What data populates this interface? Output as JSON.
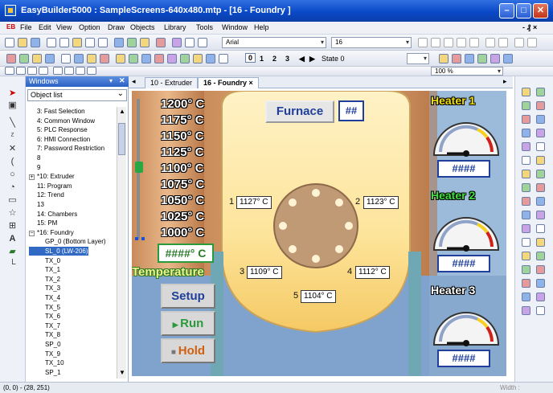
{
  "window": {
    "title": "EasyBuilder5000 : SampleScreens-640x480.mtp - [16 - Foundry ]"
  },
  "menubar": {
    "badge": "EB",
    "items": [
      "File",
      "Edit",
      "View",
      "Option",
      "Draw",
      "Objects",
      "Library",
      "Tools",
      "Window",
      "Help"
    ]
  },
  "toolbar": {
    "font_combo": "Arial",
    "size_combo": "16",
    "layers": [
      "0",
      "1",
      "2",
      "3"
    ],
    "state_label": "State 0",
    "zoom_combo": "100 %"
  },
  "panel": {
    "title": "Windows",
    "select_value": "Object list",
    "tree": [
      {
        "label": "3: Fast Selection",
        "indent": 1,
        "pm": ""
      },
      {
        "label": "4: Common Window",
        "indent": 1,
        "pm": ""
      },
      {
        "label": "5: PLC Response",
        "indent": 1,
        "pm": ""
      },
      {
        "label": "6: HMI Connection",
        "indent": 1,
        "pm": ""
      },
      {
        "label": "7: Password Restriction",
        "indent": 1,
        "pm": ""
      },
      {
        "label": "8",
        "indent": 1,
        "pm": ""
      },
      {
        "label": "9",
        "indent": 1,
        "pm": ""
      },
      {
        "label": "*10: Extruder",
        "indent": 0,
        "pm": "+"
      },
      {
        "label": "11: Program",
        "indent": 1,
        "pm": ""
      },
      {
        "label": "12: Trend",
        "indent": 1,
        "pm": ""
      },
      {
        "label": "13",
        "indent": 1,
        "pm": ""
      },
      {
        "label": "14: Chambers",
        "indent": 1,
        "pm": ""
      },
      {
        "label": "15: PM",
        "indent": 1,
        "pm": ""
      },
      {
        "label": "*16: Foundry",
        "indent": 0,
        "pm": "−"
      },
      {
        "label": "GP_0 (Bottom Layer)",
        "indent": 2,
        "pm": ""
      },
      {
        "label": "SL_0 (LW-206)",
        "indent": 2,
        "pm": "",
        "selected": true
      },
      {
        "label": "TX_0",
        "indent": 2,
        "pm": ""
      },
      {
        "label": "TX_1",
        "indent": 2,
        "pm": ""
      },
      {
        "label": "TX_2",
        "indent": 2,
        "pm": ""
      },
      {
        "label": "TX_3",
        "indent": 2,
        "pm": ""
      },
      {
        "label": "TX_4",
        "indent": 2,
        "pm": ""
      },
      {
        "label": "TX_5",
        "indent": 2,
        "pm": ""
      },
      {
        "label": "TX_6",
        "indent": 2,
        "pm": ""
      },
      {
        "label": "TX_7",
        "indent": 2,
        "pm": ""
      },
      {
        "label": "TX_8",
        "indent": 2,
        "pm": ""
      },
      {
        "label": "SP_0",
        "indent": 2,
        "pm": ""
      },
      {
        "label": "TX_9",
        "indent": 2,
        "pm": ""
      },
      {
        "label": "TX_10",
        "indent": 2,
        "pm": ""
      },
      {
        "label": "SP_1",
        "indent": 2,
        "pm": ""
      }
    ]
  },
  "tabs": [
    {
      "label": "10 - Extruder"
    },
    {
      "label": "16 - Foundry ×"
    }
  ],
  "screen": {
    "temp_scale": [
      "1200° C",
      "1175° C",
      "1150° C",
      "1125° C",
      "1100° C",
      "1075° C",
      "1050° C",
      "1025° C",
      "1000° C"
    ],
    "temp_readout": "####° C",
    "temperature_label": "Temperature",
    "furnace_label": "Furnace",
    "furnace_value": "##",
    "setup_label": "Setup",
    "run_label": "Run",
    "hold_label": "Hold",
    "sensors": [
      {
        "id": "1",
        "value": "1127° C"
      },
      {
        "id": "2",
        "value": "1123° C"
      },
      {
        "id": "3",
        "value": "1109° C"
      },
      {
        "id": "4",
        "value": "1112° C"
      },
      {
        "id": "5",
        "value": "1104° C"
      }
    ],
    "heaters": [
      {
        "title": "Heater 1",
        "title_color": "#f2e000",
        "value": "####"
      },
      {
        "title": "Heater 2",
        "title_color": "#3ee23e",
        "value": "####"
      },
      {
        "title": "Heater 3",
        "title_color": "#ffffff",
        "value": "####"
      }
    ]
  },
  "status": {
    "coords": "(0, 0) - (28, 251)",
    "width_label": "Width :"
  }
}
